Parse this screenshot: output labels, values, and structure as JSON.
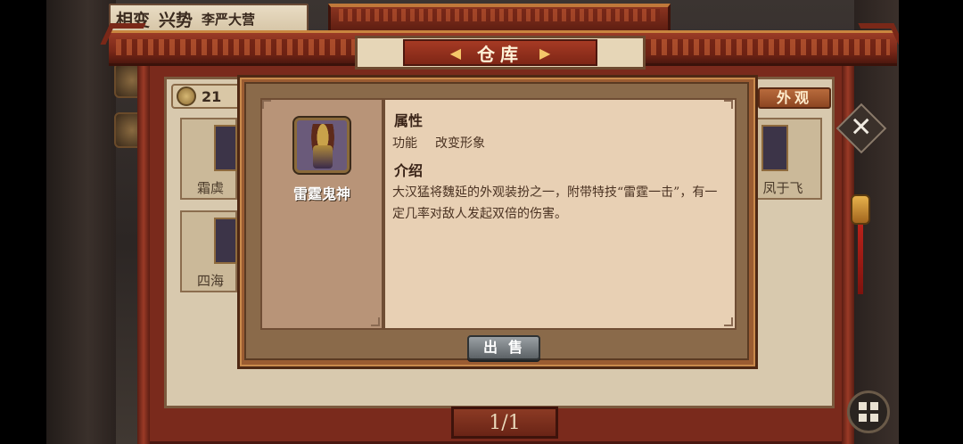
{
  "status": {
    "a": "相变",
    "b": "兴势",
    "c": "李严大营"
  },
  "warehouse": {
    "title": "仓库",
    "title_deco_left": "◀",
    "title_deco_right": "▶",
    "coin_value": "21",
    "tab_look": "外观",
    "cells": [
      "霜虡",
      "四海",
      "凤于飞"
    ],
    "page": "1/1"
  },
  "item_detail": {
    "name": "雷霆鬼神",
    "attr_heading": "属性",
    "func_label": "功能",
    "func_value": "改变形象",
    "intro_heading": "介绍",
    "intro_text": "大汉猛将魏延的外观装扮之一，附带特技“雷霆一击”，有一定几率对敌人发起双倍的伤害。",
    "sell_label": "出售"
  },
  "icons": {
    "close": "close-icon",
    "grid": "grid-menu-icon"
  },
  "colors": {
    "frame": "#7a2a1c",
    "parchment": "#e8d0b4",
    "sell_button": "#7a8084"
  }
}
